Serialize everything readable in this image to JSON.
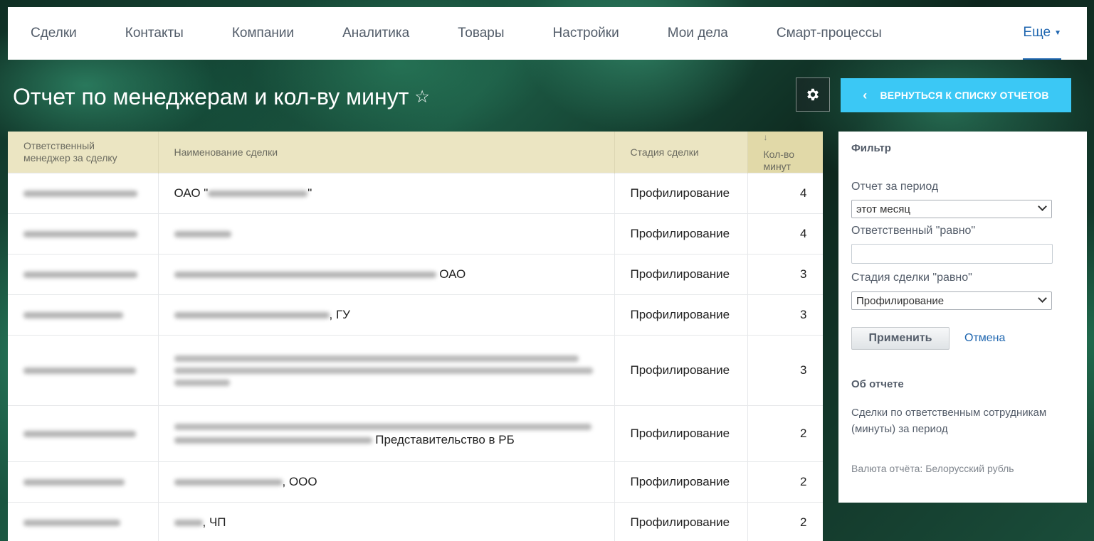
{
  "nav": {
    "items": [
      "Сделки",
      "Контакты",
      "Компании",
      "Аналитика",
      "Товары",
      "Настройки",
      "Мои дела",
      "Смарт-процессы"
    ],
    "more_label": "Еще"
  },
  "header": {
    "title": "Отчет по менеджерам и кол-ву минут",
    "back_button_label": "ВЕРНУТЬСЯ К СПИСКУ ОТЧЕТОВ"
  },
  "table": {
    "columns": [
      "Ответственный менеджер за сделку",
      "Наименование сделки",
      "Стадия сделки",
      "Кол-во минут"
    ],
    "rows": [
      {
        "deal_prefix": "ОАО \"",
        "deal_suffix": "\"",
        "stage": "Профилирование",
        "minutes": "4"
      },
      {
        "deal_prefix": "",
        "deal_suffix": "",
        "stage": "Профилирование",
        "minutes": "4"
      },
      {
        "deal_prefix": "",
        "deal_suffix": " ОАО",
        "stage": "Профилирование",
        "minutes": "3"
      },
      {
        "deal_prefix": "",
        "deal_suffix": ", ГУ",
        "stage": "Профилирование",
        "minutes": "3"
      },
      {
        "deal_prefix": "",
        "deal_suffix": "",
        "stage": "Профилирование",
        "minutes": "3"
      },
      {
        "deal_prefix": "",
        "deal_suffix": " Представительство в РБ",
        "stage": "Профилирование",
        "minutes": "2"
      },
      {
        "deal_prefix": "",
        "deal_suffix": ", ООО",
        "stage": "Профилирование",
        "minutes": "2"
      },
      {
        "deal_prefix": "",
        "deal_suffix": ", ЧП",
        "stage": "Профилирование",
        "minutes": "2"
      }
    ]
  },
  "filter": {
    "title": "Фильтр",
    "period_label": "Отчет за период",
    "period_value": "этот месяц",
    "responsible_label": "Ответственный \"равно\"",
    "responsible_value": "",
    "stage_label": "Стадия сделки \"равно\"",
    "stage_value": "Профилирование",
    "apply_label": "Применить",
    "cancel_label": "Отмена"
  },
  "about": {
    "title": "Об отчете",
    "description": "Сделки по ответственным сотрудникам (минуты) за период",
    "currency": "Валюта отчёта: Белорусский рубль"
  }
}
